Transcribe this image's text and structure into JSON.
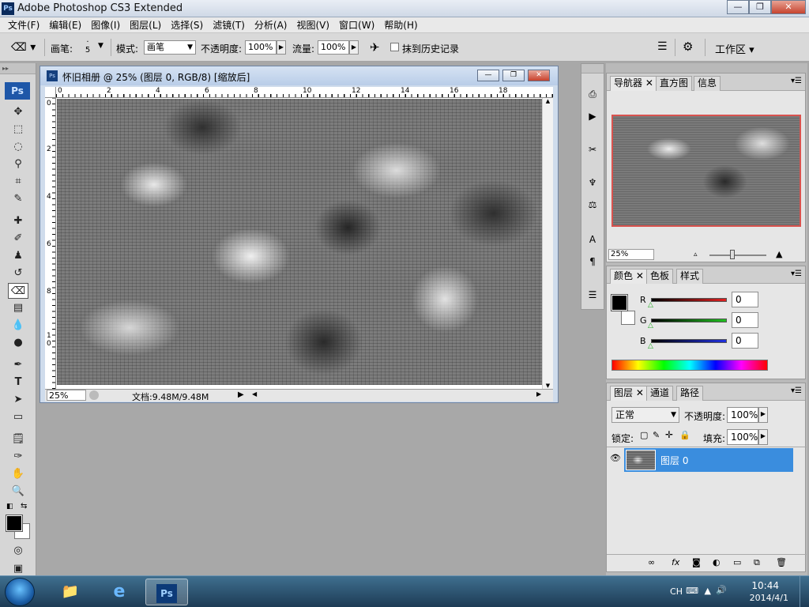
{
  "app": {
    "title": "Adobe Photoshop CS3 Extended",
    "logo": "Ps"
  },
  "window_buttons": {
    "minimize": "—",
    "restore": "❐",
    "close": "✕"
  },
  "menu": [
    "文件(F)",
    "编辑(E)",
    "图像(I)",
    "图层(L)",
    "选择(S)",
    "滤镜(T)",
    "分析(A)",
    "视图(V)",
    "窗口(W)",
    "帮助(H)"
  ],
  "options": {
    "brush_label": "画笔:",
    "brush_size": "5",
    "mode_label": "模式:",
    "mode_value": "画笔",
    "opacity_label": "不透明度:",
    "opacity_value": "100%",
    "flow_label": "流量:",
    "flow_value": "100%",
    "history_label": "抹到历史记录",
    "workspace_label": "工作区"
  },
  "toolbox": {
    "logo": "Ps"
  },
  "document": {
    "title": "怀旧相册 @ 25% (图层 0, RGB/8) [缩放后]",
    "hruler": [
      "0",
      "2",
      "4",
      "6",
      "8",
      "10",
      "12",
      "14",
      "16",
      "18"
    ],
    "vruler": [
      "0",
      "2",
      "4",
      "6",
      "8",
      "1\n0"
    ],
    "zoom": "25%",
    "doc_info": "文档:9.48M/9.48M"
  },
  "navigator": {
    "tabs": [
      "导航器",
      "直方图",
      "信息"
    ],
    "zoom": "25%"
  },
  "color_panel": {
    "tabs": [
      "颜色",
      "色板",
      "样式"
    ],
    "channels": [
      {
        "label": "R",
        "value": "0",
        "color": "#cc2020"
      },
      {
        "label": "G",
        "value": "0",
        "color": "#20b020"
      },
      {
        "label": "B",
        "value": "0",
        "color": "#2030d0"
      }
    ]
  },
  "layers_panel": {
    "tabs": [
      "图层",
      "通道",
      "路径"
    ],
    "blend_mode": "正常",
    "opacity_label": "不透明度:",
    "opacity_value": "100%",
    "lock_label": "锁定:",
    "fill_label": "填充:",
    "fill_value": "100%",
    "layers": [
      {
        "name": "图层 0",
        "visible": true
      }
    ]
  },
  "taskbar": {
    "tray_lang": "CH",
    "time": "10:44",
    "date": "2014/4/1",
    "ps_icon": "Ps"
  }
}
